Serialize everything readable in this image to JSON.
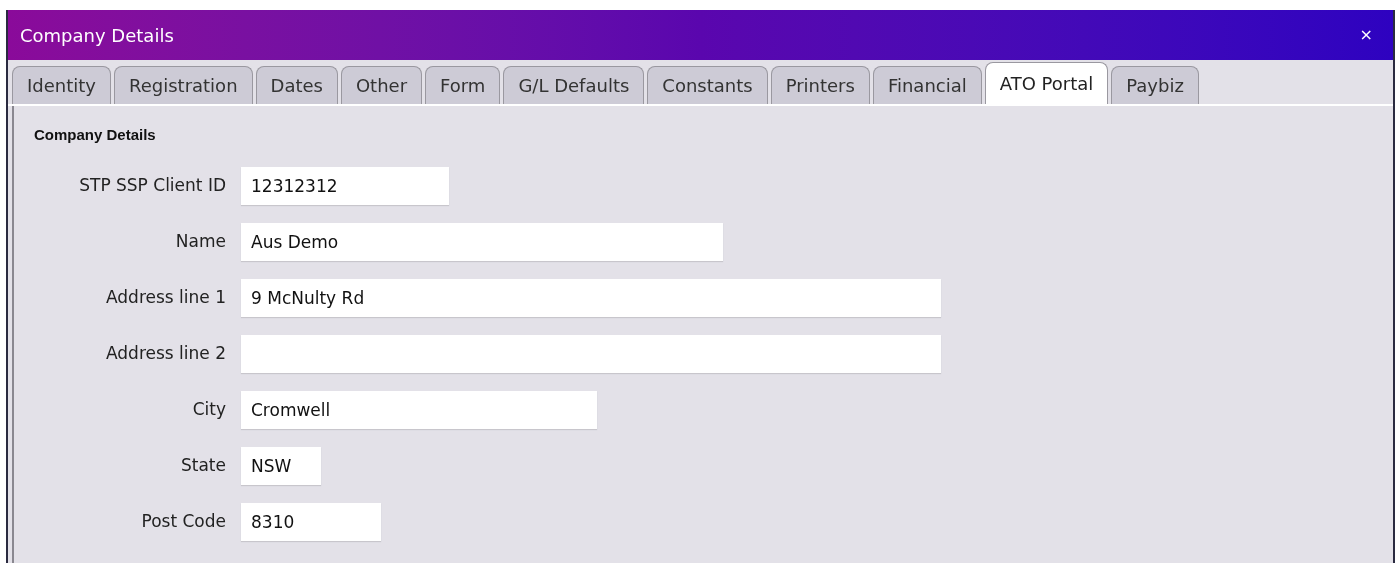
{
  "window": {
    "title": "Company Details",
    "close": "×"
  },
  "tabs": [
    {
      "label": "Identity",
      "selected": false
    },
    {
      "label": "Registration",
      "selected": false
    },
    {
      "label": "Dates",
      "selected": false
    },
    {
      "label": "Other",
      "selected": false
    },
    {
      "label": "Form",
      "selected": false
    },
    {
      "label": "G/L Defaults",
      "selected": false
    },
    {
      "label": "Constants",
      "selected": false
    },
    {
      "label": "Printers",
      "selected": false
    },
    {
      "label": "Financial",
      "selected": false
    },
    {
      "label": "ATO Portal",
      "selected": true
    },
    {
      "label": "Paybiz",
      "selected": false
    }
  ],
  "section": {
    "title": "Company Details"
  },
  "fields": [
    {
      "label": "STP SSP Client ID",
      "value": "12312312"
    },
    {
      "label": "Name",
      "value": "Aus Demo"
    },
    {
      "label": "Address line 1",
      "value": "9 McNulty Rd"
    },
    {
      "label": "Address line 2"
    },
    {
      "label": "City",
      "value": "Cromwell"
    },
    {
      "label": "State",
      "value": "NSW"
    },
    {
      "label": "Post Code",
      "value": "8310"
    }
  ]
}
